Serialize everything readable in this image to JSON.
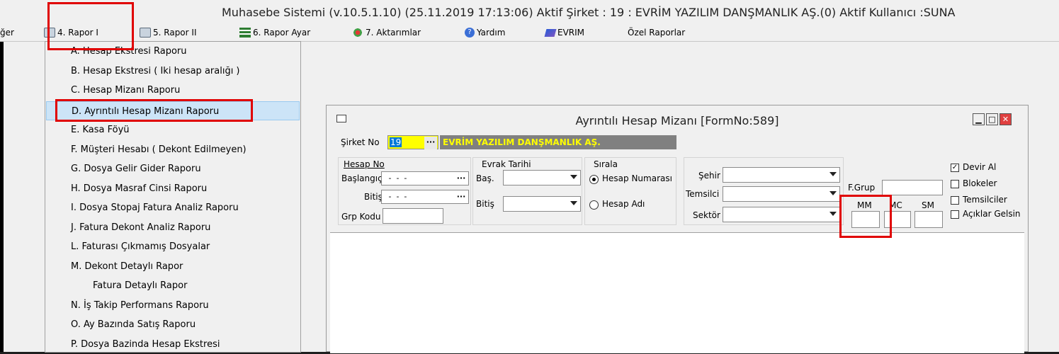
{
  "titlebar": {
    "text": "Muhasebe Sistemi (v.10.5.1.10) (25.11.2019 17:13:06) Aktif Şirket : 19 : EVRİM YAZILIM DANŞMANLIK AŞ.(0) Aktif Kullanıcı :SUNA"
  },
  "menubar": {
    "items": [
      {
        "label": "ğer"
      },
      {
        "label": "4.  Rapor I"
      },
      {
        "label": "5.  Rapor II"
      },
      {
        "label": "6.  Rapor Ayar"
      },
      {
        "label": "7.  Aktarımlar"
      },
      {
        "label": "Yardım"
      },
      {
        "label": "EVRIM"
      },
      {
        "label": "Özel Raporlar"
      }
    ]
  },
  "dropdown": {
    "items": [
      {
        "label": "A.  Hesap Ekstresi Raporu"
      },
      {
        "label": "B.  Hesap Ekstresi ( Iki hesap aralığı )"
      },
      {
        "label": "C.  Hesap Mizanı Raporu"
      },
      {
        "label": "D.  Ayrıntılı Hesap Mizanı Raporu"
      },
      {
        "label": "E.  Kasa Föyü"
      },
      {
        "label": "F.  Müşteri Hesabı ( Dekont Edilmeyen)"
      },
      {
        "label": "G.  Dosya Gelir Gider Raporu"
      },
      {
        "label": "H.  Dosya Masraf Cinsi Raporu"
      },
      {
        "label": "I.  Dosya Stopaj Fatura Analiz Raporu"
      },
      {
        "label": "J.  Fatura Dekont Analiz Raporu"
      },
      {
        "label": "L.  Faturası Çıkmamış Dosyalar"
      },
      {
        "label": "M.  Dekont Detaylı Rapor"
      },
      {
        "label": "Fatura Detaylı Rapor"
      },
      {
        "label": "N.  İş Takip Performans Raporu"
      },
      {
        "label": "O.  Ay Bazında Satış Raporu"
      },
      {
        "label": "P.  Dosya Bazinda Hesap Ekstresi"
      }
    ]
  },
  "window": {
    "title": "Ayrıntılı Hesap Mizanı [FormNo:589]",
    "sirket_label": "Şirket No",
    "sirket_no": "19",
    "sirket_name": "EVRİM YAZILIM DANŞMANLIK AŞ.",
    "hesap_group": "Hesap No",
    "baslangic_label": "Başlangıç",
    "baslangic_value": " -  -  - ",
    "bitis_label": "Bitiş",
    "bitis_value": " -  -  - ",
    "grp_kodu_label": "Grp Kodu",
    "evrak_group": "Evrak Tarihi",
    "bas_label": "Baş.",
    "evrak_bitis_label": "Bitiş",
    "sirala_group": "Sırala",
    "radio_hesap_no": "Hesap Numarası",
    "radio_hesap_adi": "Hesap Adı",
    "sehir_label": "Şehir",
    "temsilci_label": "Temsilci",
    "sektor_label": "Sektör",
    "fgrup_label": "F.Grup",
    "mm_label": "MM",
    "mc_label": "MC",
    "sm_label": "SM",
    "check_devir": "Devir Al",
    "check_blokeler": "Blokeler",
    "check_temsilciler": "Temsilciler",
    "check_aciklar": "Açıklar Gelsin"
  },
  "colors": {
    "highlight_box": "#e00000",
    "sirket_field_bg": "#ffff00",
    "sirket_name_bg": "#808080",
    "sirket_name_text": "#ffff00"
  }
}
